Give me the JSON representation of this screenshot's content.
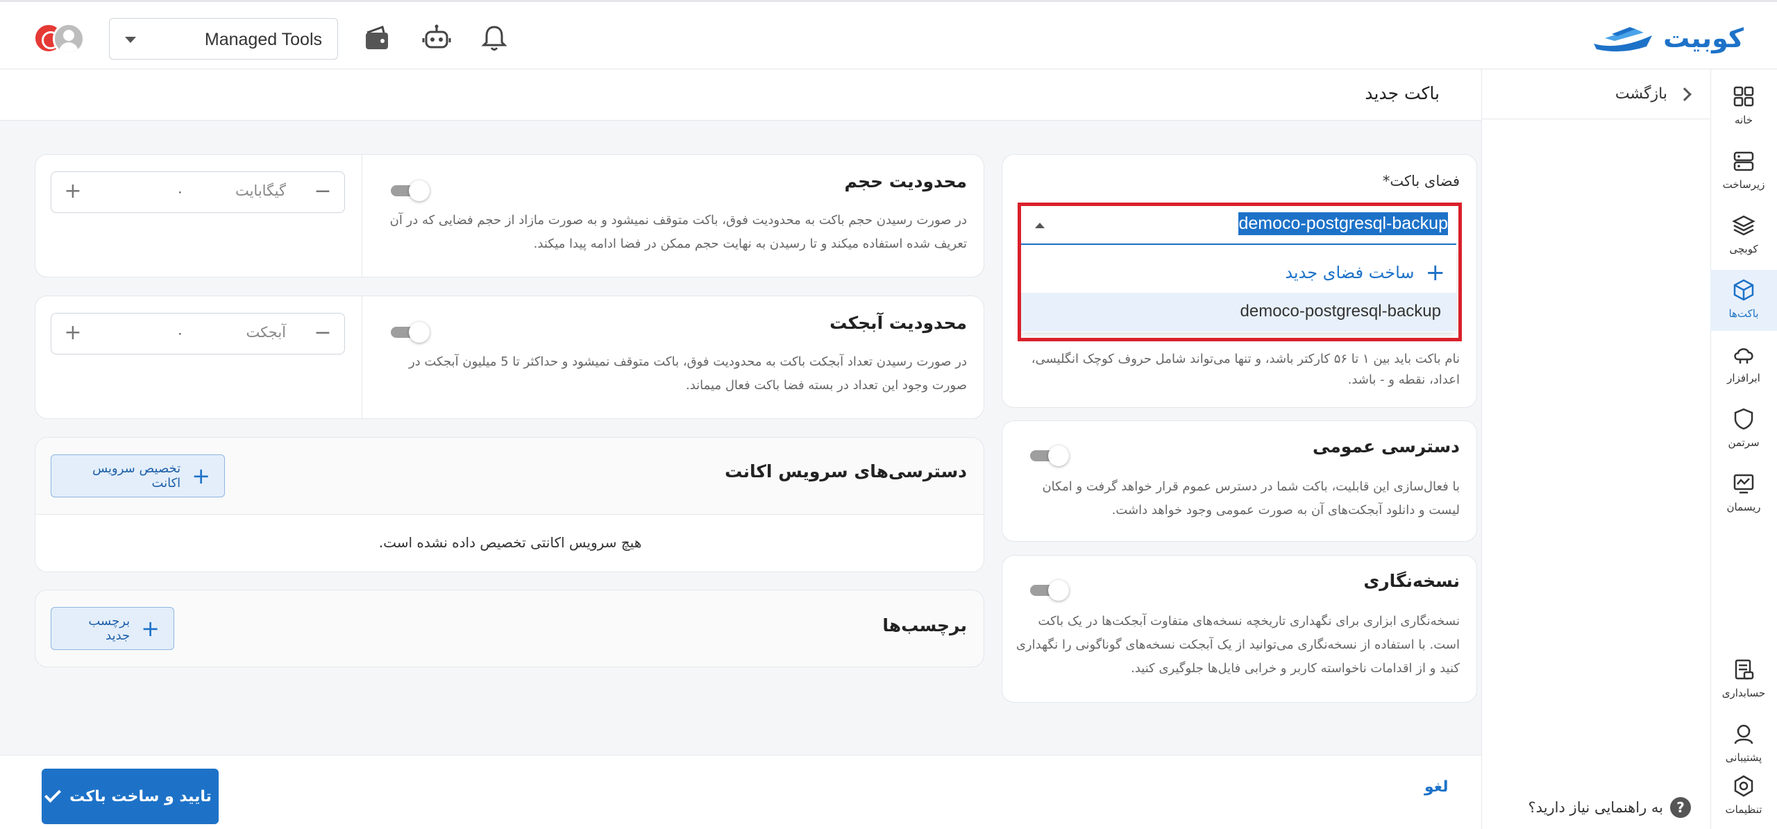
{
  "header": {
    "logo_text": "کوبیت",
    "org_select_value": "Managed Tools",
    "icons": [
      "bell-icon",
      "robot-icon",
      "wallet-icon"
    ]
  },
  "rail": {
    "items": [
      {
        "label": "خانه",
        "icon": "home-grid-icon"
      },
      {
        "label": "زیرساخت",
        "icon": "server-icon"
      },
      {
        "label": "کوبچی",
        "icon": "layers-icon"
      },
      {
        "label": "باکت‌ها",
        "icon": "cube-icon",
        "active": true
      },
      {
        "label": "ابرافزار",
        "icon": "cloud-app-icon"
      },
      {
        "label": "سرتمن",
        "icon": "shield-icon"
      },
      {
        "label": "ریسمان",
        "icon": "monitor-graph-icon"
      },
      {
        "label": "حسابداری",
        "icon": "invoice-icon"
      },
      {
        "label": "پشتیبانی",
        "icon": "support-icon"
      },
      {
        "label": "تنظیمات",
        "icon": "gear-icon"
      }
    ]
  },
  "backpanel": {
    "back_label": "بازگشت",
    "help_label": "به راهنمایی نیاز دارید؟",
    "help_icon": "?"
  },
  "page": {
    "title": "باکت جدید"
  },
  "bucket_space": {
    "label": "فضای باکت*",
    "selected": "democo-postgresql-backup",
    "new_space_label": "ساخت فضای جدید",
    "options": [
      "democo-postgresql-backup"
    ],
    "hint": "نام باکت باید بین ۱ تا ۵۶ کارکتر باشد، و تنها می‌تواند شامل حروف کوچک انگلیسی، اعداد، نقطه و - باشد."
  },
  "public_access": {
    "title": "دسترسی عمومی",
    "desc": "با فعال‌سازی این قابلیت، باکت شما در دسترس عموم قرار خواهد گرفت و امکان لیست و دانلود آبجکت‌های آن به صورت عمومی وجود خواهد داشت."
  },
  "versioning": {
    "title": "نسخه‌نگاری",
    "desc": "نسخه‌نگاری ابزاری برای نگهداری تاریخچه نسخه‌های متفاوت آبجکت‌ها در یک باکت است. با استفاده از نسخه‌نگاری می‌توانید از یک آبجکت نسخه‌های گوناگونی را نگهداری کنید و از اقدامات ناخواسته کاربر و خرابی فایل‌ها جلوگیری کنید."
  },
  "size_limit": {
    "title": "محدودیت حجم",
    "desc": "در صورت رسیدن حجم باکت به محدودیت فوق، باکت متوقف نمیشود و به صورت مازاد از حجم فضایی که در آن تعریف شده استفاده میکند و تا رسیدن به نهایت حجم ممکن در فضا ادامه پیدا میکند.",
    "value": "۰",
    "unit": "گیگابایت"
  },
  "object_limit": {
    "title": "محدودیت آبجکت",
    "desc": "در صورت رسیدن تعداد آبجکت باکت به محدودیت فوق، باکت متوقف نمیشود و حداکثر تا 5 میلیون آبجکت در صورت وجود این تعداد در بسته فضا باکت فعال میماند.",
    "value": "۰",
    "unit": "آبجکت"
  },
  "service_accounts": {
    "title": "دسترسی‌های سرویس اکانت",
    "button": "تخصیص سرویس اکانت",
    "empty": "هیچ سرویس اکانتی تخصیص داده نشده است."
  },
  "tags": {
    "title": "برچسب‌ها",
    "button": "برچسب جدید"
  },
  "footer": {
    "confirm": "تایید و ساخت باکت",
    "cancel": "لغو"
  },
  "stepper_symbols": {
    "minus": "−",
    "plus": "+"
  },
  "colors": {
    "accent": "#1d72c8",
    "highlight": "#d9202b"
  }
}
